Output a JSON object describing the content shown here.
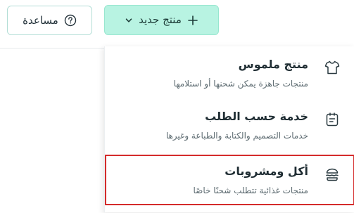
{
  "toolbar": {
    "help_label": "مساعدة",
    "new_product_label": "منتج جديد"
  },
  "menu": {
    "items": [
      {
        "title": "منتج ملموس",
        "description": "منتجات جاهزة يمكن شحنها أو استلامها",
        "icon": "tshirt-icon"
      },
      {
        "title": "خدمة حسب الطلب",
        "description": "خدمات التصميم والكتابة والطباعة وغيرها",
        "icon": "clipboard-icon"
      },
      {
        "title": "أكل ومشروبات",
        "description": "منتجات غذائية تتطلب شحنًا خاصًا",
        "icon": "burger-icon"
      }
    ],
    "highlighted_index": 2,
    "highlight_color": "#d42b2b"
  },
  "colors": {
    "accent_bg": "#b8f3e2",
    "accent_border": "#97e6cf",
    "outline_border": "#b3ded6"
  }
}
